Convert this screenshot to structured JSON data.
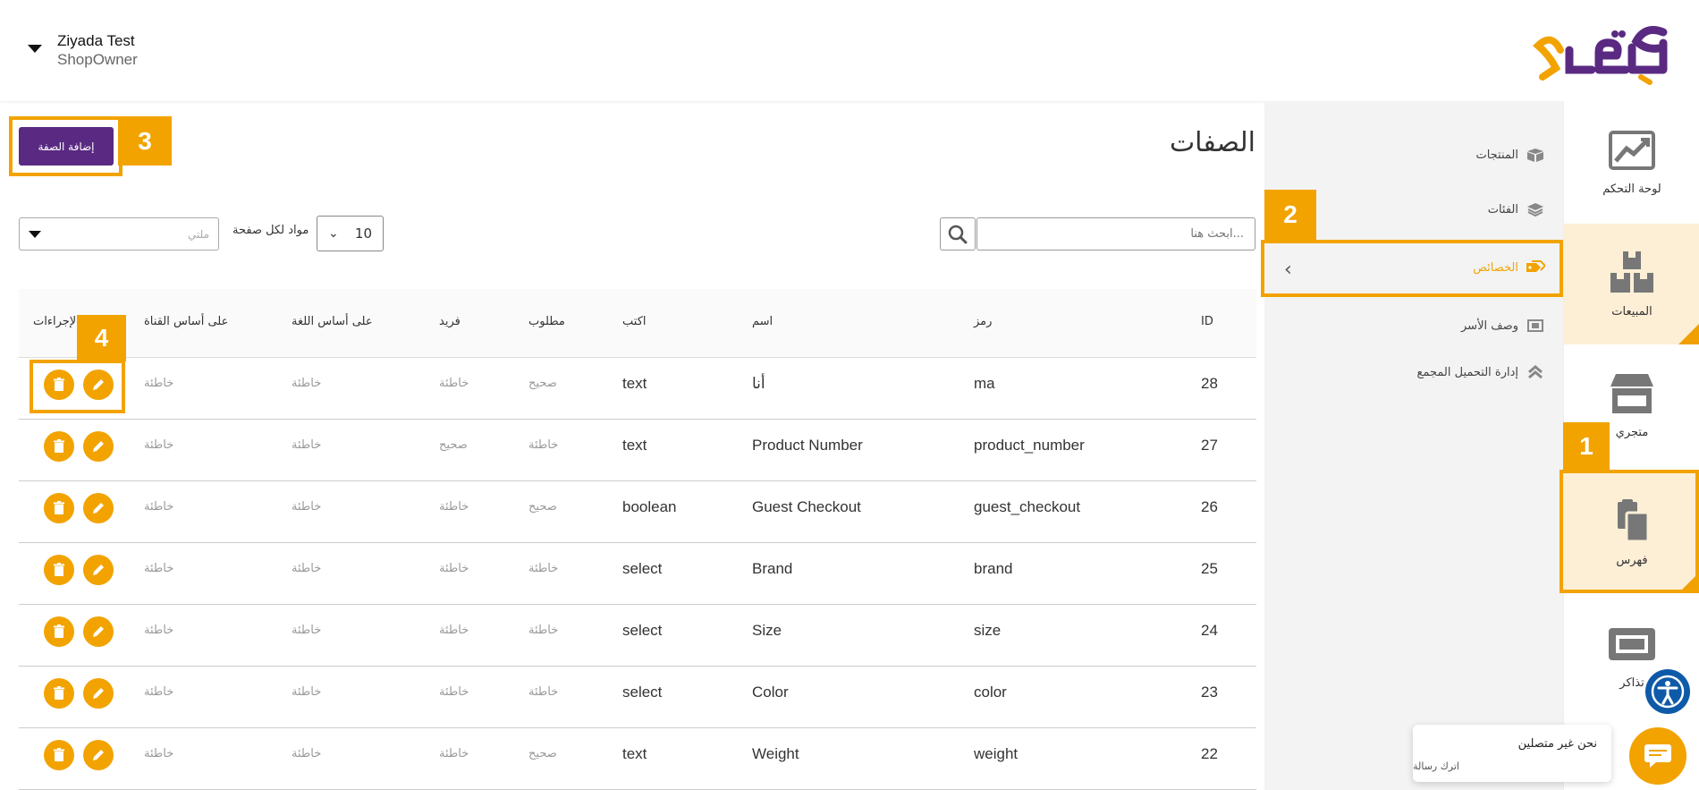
{
  "user": {
    "name": "Ziyada Test",
    "role": "ShopOwner"
  },
  "brand": {
    "accent": "#f2a300",
    "primary": "#5a2a82"
  },
  "rail": [
    {
      "label": "لوحة التحكم",
      "icon": "chart-icon"
    },
    {
      "label": "المبيعات",
      "icon": "boxes-icon"
    },
    {
      "label": "متجري",
      "icon": "store-icon"
    },
    {
      "label": "فهرس",
      "icon": "catalog-icon"
    },
    {
      "label": "تذاكر",
      "icon": "ticket-icon"
    }
  ],
  "subnav": [
    {
      "label": "المنتجات",
      "icon": "box-icon"
    },
    {
      "label": "الفئات",
      "icon": "layers-icon"
    },
    {
      "label": "الخصائص",
      "icon": "tags-icon"
    },
    {
      "label": "وصف الأسر",
      "icon": "family-icon"
    },
    {
      "label": "إدارة التحميل المجمع",
      "icon": "upload-icon"
    }
  ],
  "page": {
    "title": "الصفات",
    "add_button": "إضافة الصفة",
    "search_placeholder": "...ابحث هنا",
    "per_page_value": "10",
    "per_page_label": "مواد لكل صفحة",
    "filter_placeholder": "ملتي"
  },
  "annotations": [
    "1",
    "2",
    "3",
    "4"
  ],
  "table": {
    "headers": {
      "id": "ID",
      "code": "رمز",
      "name": "اسم",
      "type": "اكتب",
      "required": "مطلوب",
      "unique": "فريد",
      "locale_based": "على أساس اللغة",
      "channel_based": "على أساس القناة",
      "actions": "الإجراءات"
    },
    "rows": [
      {
        "id": "28",
        "code": "ma",
        "name": "أنا",
        "type": "text",
        "required": "صحيح",
        "unique": "خاطئة",
        "locale": "خاطئة",
        "channel": "خاطئة"
      },
      {
        "id": "27",
        "code": "product_number",
        "name": "Product Number",
        "type": "text",
        "required": "خاطئة",
        "unique": "صحيح",
        "locale": "خاطئة",
        "channel": "خاطئة"
      },
      {
        "id": "26",
        "code": "guest_checkout",
        "name": "Guest Checkout",
        "type": "boolean",
        "required": "صحيح",
        "unique": "خاطئة",
        "locale": "خاطئة",
        "channel": "خاطئة"
      },
      {
        "id": "25",
        "code": "brand",
        "name": "Brand",
        "type": "select",
        "required": "خاطئة",
        "unique": "خاطئة",
        "locale": "خاطئة",
        "channel": "خاطئة"
      },
      {
        "id": "24",
        "code": "size",
        "name": "Size",
        "type": "select",
        "required": "خاطئة",
        "unique": "خاطئة",
        "locale": "خاطئة",
        "channel": "خاطئة"
      },
      {
        "id": "23",
        "code": "color",
        "name": "Color",
        "type": "select",
        "required": "خاطئة",
        "unique": "خاطئة",
        "locale": "خاطئة",
        "channel": "خاطئة"
      },
      {
        "id": "22",
        "code": "weight",
        "name": "Weight",
        "type": "text",
        "required": "صحيح",
        "unique": "خاطئة",
        "locale": "خاطئة",
        "channel": "خاطئة"
      }
    ]
  },
  "chat": {
    "status": "نحن غير متصلين",
    "sub": "اترك رسالة"
  }
}
